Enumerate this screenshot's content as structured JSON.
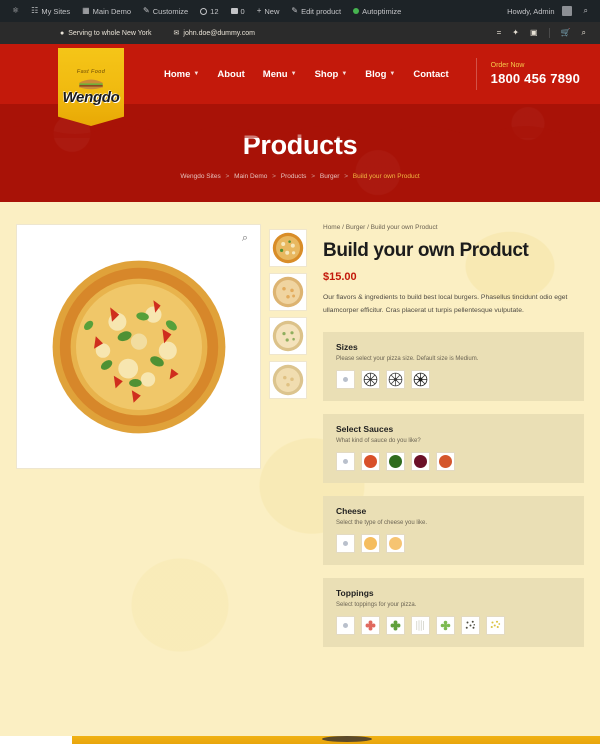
{
  "admin_bar": {
    "items": [
      {
        "icon": "wordpress-icon",
        "glyph": "Ⓦ",
        "label": ""
      },
      {
        "icon": "my-sites-icon",
        "glyph": "⌂",
        "label": "My Sites"
      },
      {
        "icon": "site-icon",
        "glyph": "▤",
        "label": "Main Demo"
      },
      {
        "icon": "customize-icon",
        "glyph": "✎",
        "label": "Customize"
      },
      {
        "icon": "updates-icon",
        "glyph": "↻",
        "label": "12"
      },
      {
        "icon": "comments-icon",
        "glyph": "▰",
        "label": "0"
      },
      {
        "icon": "new-icon",
        "glyph": "＋",
        "label": "New"
      },
      {
        "icon": "edit-icon",
        "glyph": "✎",
        "label": "Edit product"
      },
      {
        "icon": "autoptimize-icon",
        "glyph": "●",
        "label": "Autoptimize"
      }
    ],
    "howdy": "Howdy, Admin",
    "search_icon": "search-icon"
  },
  "topbar": {
    "location_icon": "map-pin-icon",
    "location": "Serving to whole New York",
    "email_icon": "envelope-icon",
    "email": "john.doe@dummy.com",
    "social": [
      {
        "name": "facebook-icon",
        "glyph": "f"
      },
      {
        "name": "twitter-icon",
        "glyph": "🐦"
      },
      {
        "name": "instagram-icon",
        "glyph": "◙"
      }
    ],
    "cart_icon": "cart-icon",
    "search_icon": "search-icon"
  },
  "branding": {
    "tagline": "Fast Food",
    "name": "Wengdo"
  },
  "nav": {
    "items": [
      {
        "label": "Home",
        "has_dropdown": true
      },
      {
        "label": "About",
        "has_dropdown": false
      },
      {
        "label": "Menu",
        "has_dropdown": true
      },
      {
        "label": "Shop",
        "has_dropdown": true
      },
      {
        "label": "Blog",
        "has_dropdown": true
      },
      {
        "label": "Contact",
        "has_dropdown": false
      }
    ],
    "order_label": "Order Now",
    "order_phone": "1800 456 7890"
  },
  "hero": {
    "title": "Products",
    "breadcrumb": [
      {
        "label": "Wengdo Sites",
        "current": false
      },
      {
        "label": "Main Demo",
        "current": false
      },
      {
        "label": "Products",
        "current": false
      },
      {
        "label": "Burger",
        "current": false
      },
      {
        "label": "Build your own Product",
        "current": true
      }
    ],
    "separator": ">"
  },
  "product": {
    "mini_breadcrumb": "Home / Burger / Build your own Product",
    "title": "Build your own Product",
    "price": "$15.00",
    "description": "Our flavors & ingredients to build best local burgers. Phasellus tincidunt odio eget ullamcorper efficitur. Cras placerat ut turpis pellentesque vulputate.",
    "zoom_icon": "magnifier-icon",
    "gallery": {
      "main_alt": "pizza-main-image",
      "thumbnails": [
        {
          "name": "thumbnail-pizza-1",
          "crust": "#d98d28",
          "cheese": "#e8b860",
          "active": true
        },
        {
          "name": "thumbnail-pizza-2",
          "crust": "#ddb472",
          "cheese": "#f0d4a0",
          "active": false
        },
        {
          "name": "thumbnail-pizza-3",
          "crust": "#dcc289",
          "cheese": "#f4e2bb",
          "active": false
        },
        {
          "name": "thumbnail-pizza-4",
          "crust": "#dcc48e",
          "cheese": "#f1ddb0",
          "active": false
        }
      ]
    },
    "options": [
      {
        "id": "sizes",
        "title": "Sizes",
        "subtitle": "Please select your pizza size. Default size is Medium.",
        "swatches": [
          {
            "name": "swatch-reset",
            "type": "reset"
          },
          {
            "name": "swatch-size-small",
            "type": "wheel",
            "color": "#2b2b2b"
          },
          {
            "name": "swatch-size-medium",
            "type": "wheel",
            "color": "#3a3a3a"
          },
          {
            "name": "swatch-size-large",
            "type": "wheel",
            "color": "#1f1f1f"
          }
        ]
      },
      {
        "id": "sauces",
        "title": "Select Sauces",
        "subtitle": "What kind of sauce do you like?",
        "swatches": [
          {
            "name": "swatch-reset",
            "type": "reset"
          },
          {
            "name": "swatch-sauce-tomato",
            "type": "dot",
            "color": "#d8502a"
          },
          {
            "name": "swatch-sauce-pesto",
            "type": "dot",
            "color": "#2f6b1e"
          },
          {
            "name": "swatch-sauce-bbq",
            "type": "dot",
            "color": "#6b1028"
          },
          {
            "name": "swatch-sauce-chili",
            "type": "dot",
            "color": "#d4562c"
          }
        ]
      },
      {
        "id": "cheese",
        "title": "Cheese",
        "subtitle": "Select the type of cheese you like.",
        "swatches": [
          {
            "name": "swatch-reset",
            "type": "reset"
          },
          {
            "name": "swatch-cheese-cheddar",
            "type": "dot",
            "color": "#f5bd5e"
          },
          {
            "name": "swatch-cheese-mozzarella",
            "type": "dot",
            "color": "#f6c472"
          }
        ]
      },
      {
        "id": "toppings",
        "title": "Toppings",
        "subtitle": "Select toppings for your pizza.",
        "swatches": [
          {
            "name": "swatch-reset",
            "type": "reset"
          },
          {
            "name": "swatch-topping-pepperoni",
            "type": "cluster",
            "color": "#e0695e"
          },
          {
            "name": "swatch-topping-broccoli",
            "type": "cluster",
            "color": "#5fa03b"
          },
          {
            "name": "swatch-topping-onion",
            "type": "cluster",
            "color": "#cfcfc4"
          },
          {
            "name": "swatch-topping-herbs",
            "type": "cluster",
            "color": "#7cba50"
          },
          {
            "name": "swatch-topping-olives",
            "type": "specks",
            "color": "#4c4a3e"
          },
          {
            "name": "swatch-topping-corn",
            "type": "specks",
            "color": "#d9c23f"
          }
        ]
      }
    ]
  }
}
